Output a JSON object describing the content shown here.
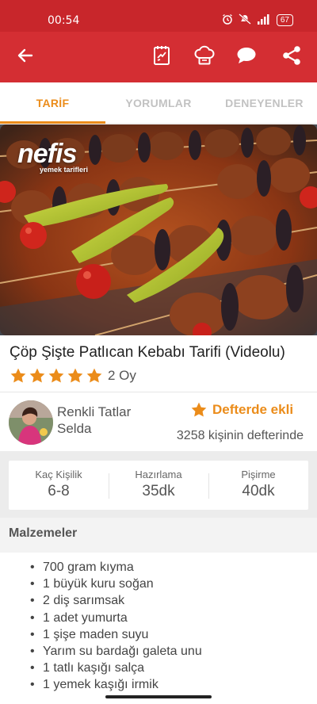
{
  "status_bar": {
    "time": "00:54",
    "battery": "67",
    "icons": [
      "alarm-icon",
      "mute-icon",
      "signal-icon",
      "battery-icon"
    ]
  },
  "toolbar": {
    "icons": [
      "back-arrow-icon",
      "notebook-icon",
      "chef-hat-icon",
      "comment-icon",
      "share-icon"
    ],
    "color": "#d42e33"
  },
  "tabs": [
    {
      "label": "TARİF",
      "active": true
    },
    {
      "label": "YORUMLAR",
      "active": false
    },
    {
      "label": "DENEYENLER",
      "active": false
    }
  ],
  "hero": {
    "logo_text": "nefis",
    "logo_subtext": "yemek tarifleri"
  },
  "recipe": {
    "title": "Çöp Şişte Patlıcan Kebabı Tarifi (Videolu)",
    "stars": 5,
    "vote_text": "2 Oy"
  },
  "author": {
    "name_line1": "Renkli Tatlar",
    "name_line2": "Selda"
  },
  "favorite": {
    "label": "Defterde ekli",
    "count_text": "3258 kişinin defterinde"
  },
  "info": [
    {
      "label": "Kaç Kişilik",
      "value": "6-8"
    },
    {
      "label": "Hazırlama",
      "value": "35dk"
    },
    {
      "label": "Pişirme",
      "value": "40dk"
    }
  ],
  "ingredients": {
    "heading": "Malzemeler",
    "items": [
      "700 gram kıyma",
      "1 büyük kuru soğan",
      "2 diş sarımsak",
      "1 adet yumurta",
      "1 şişe maden suyu",
      "Yarım su bardağı galeta unu",
      "1 tatlı kaşığı salça",
      "1 yemek kaşığı irmik"
    ]
  },
  "colors": {
    "brand_red": "#d42e33",
    "accent_orange": "#eb8c1a"
  }
}
